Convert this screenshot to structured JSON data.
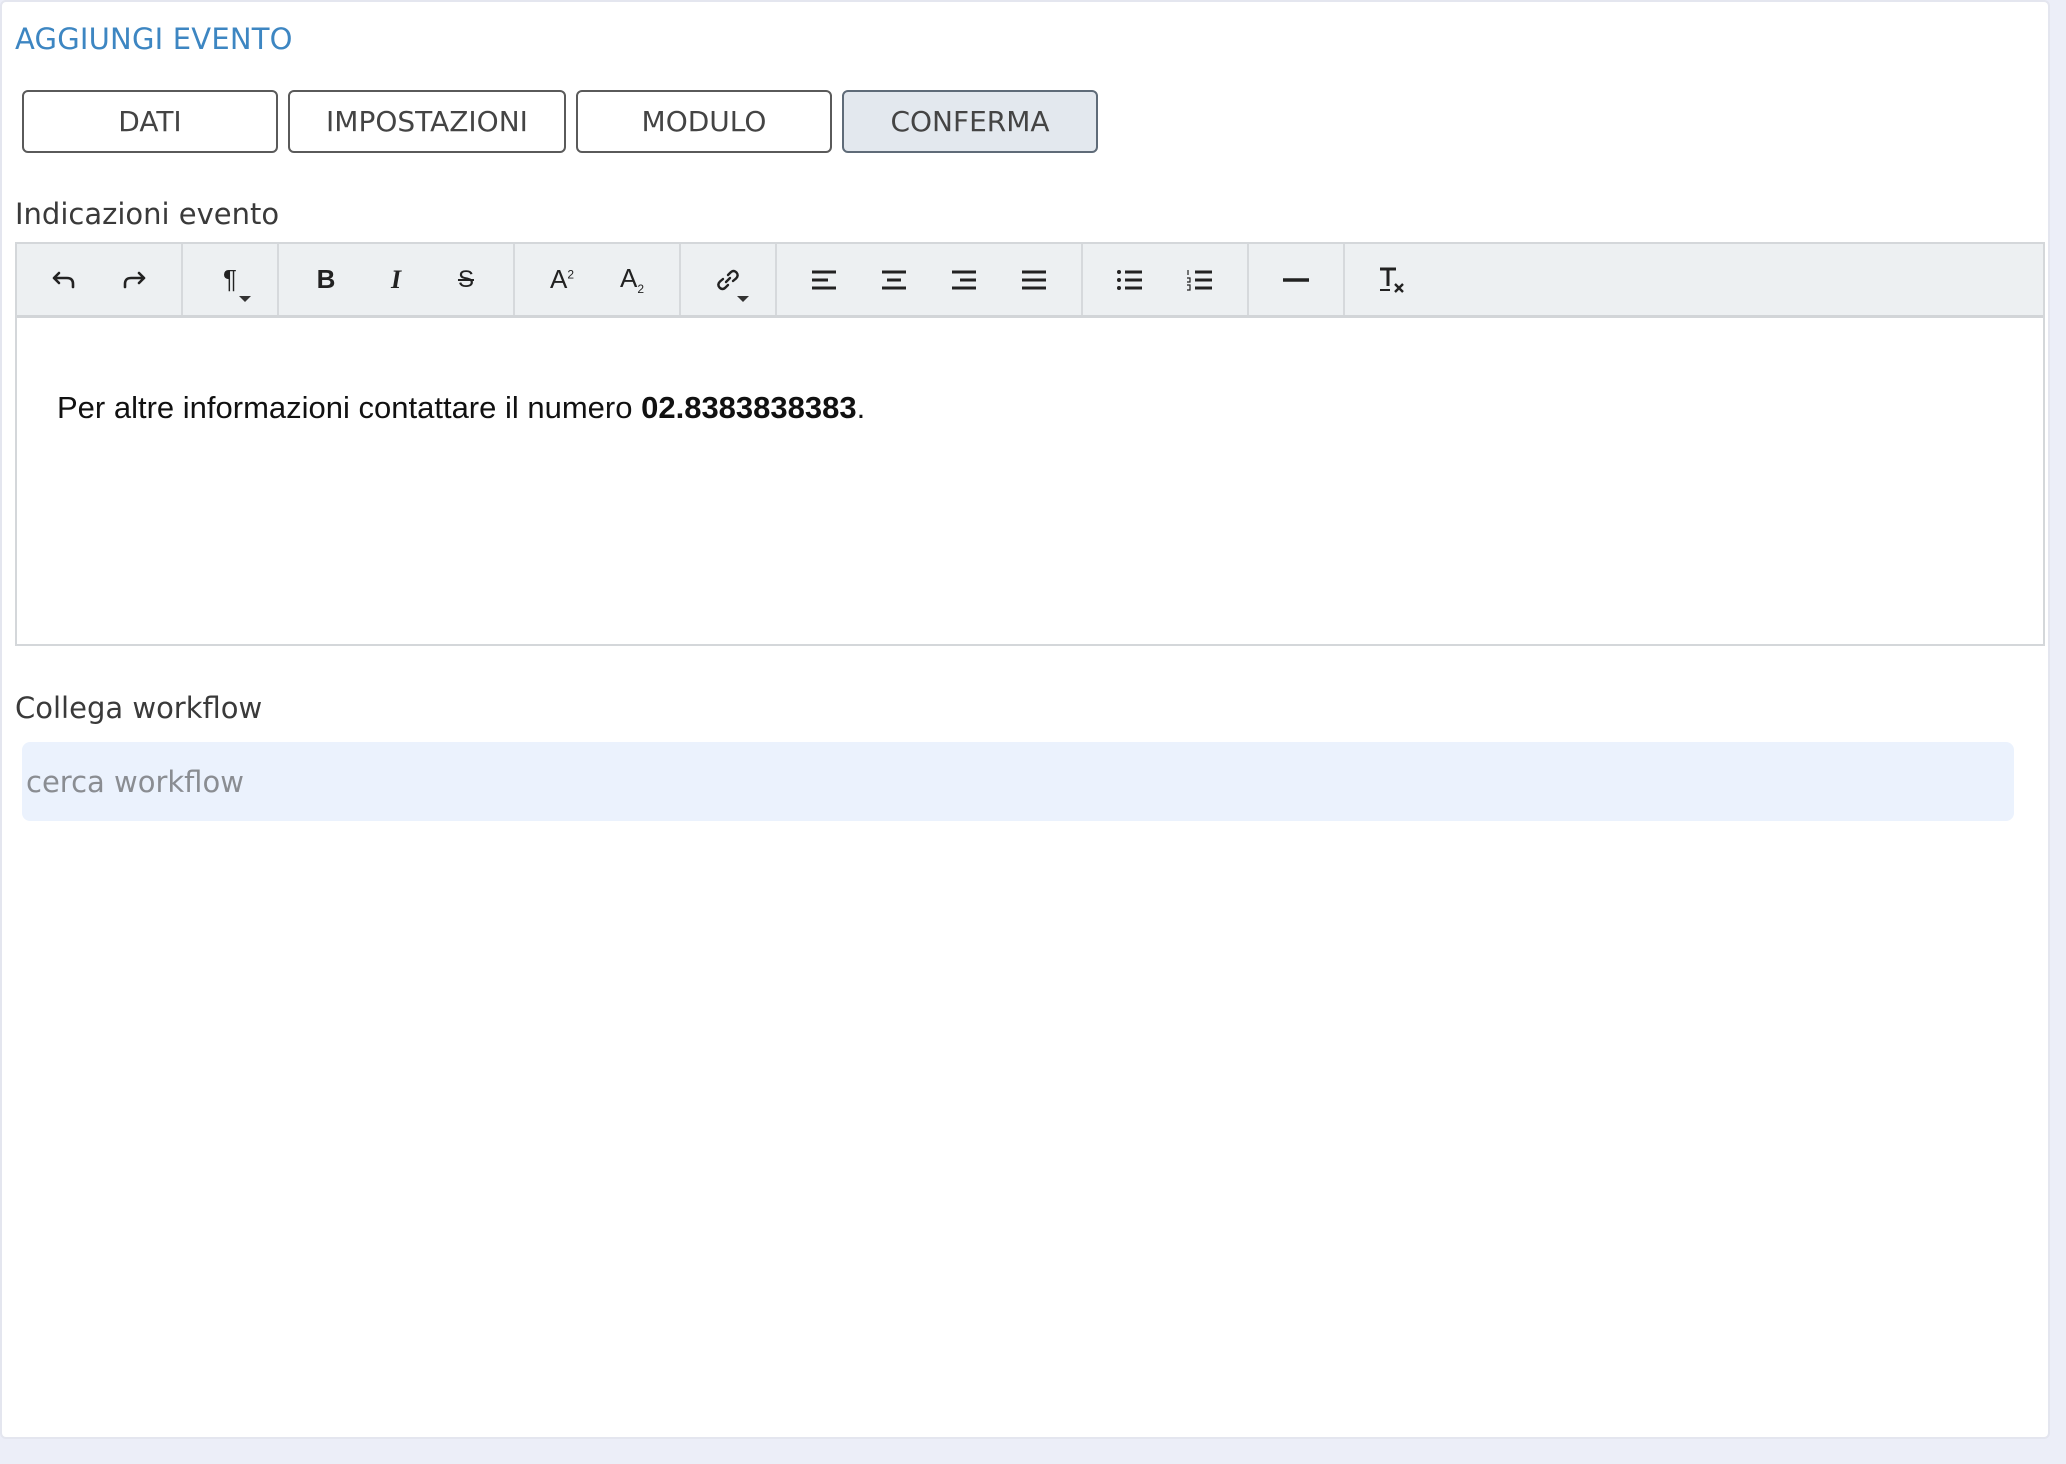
{
  "page": {
    "title": "AGGIUNGI EVENTO"
  },
  "tabs": [
    {
      "label": "DATI",
      "active": false
    },
    {
      "label": "IMPOSTAZIONI",
      "active": false
    },
    {
      "label": "MODULO",
      "active": false
    },
    {
      "label": "CONFERMA",
      "active": true
    }
  ],
  "editor": {
    "label": "Indicazioni evento",
    "content_text": "Per altre informazioni contattare il numero ",
    "content_bold": "02.8383838383",
    "content_end": "."
  },
  "workflow": {
    "label": "Collega workflow",
    "placeholder": "cerca workflow",
    "value": ""
  },
  "toolbar_icons": [
    "undo-icon",
    "redo-icon",
    "paragraph-icon",
    "bold-icon",
    "italic-icon",
    "strikethrough-icon",
    "superscript-icon",
    "subscript-icon",
    "link-icon",
    "align-left-icon",
    "align-center-icon",
    "align-right-icon",
    "align-justify-icon",
    "bullet-list-icon",
    "numbered-list-icon",
    "horizontal-rule-icon",
    "clear-format-icon"
  ],
  "colors": {
    "title": "#3d86c2",
    "active_tab_bg": "#e3e8ee",
    "search_bg": "#ebf2fd"
  }
}
